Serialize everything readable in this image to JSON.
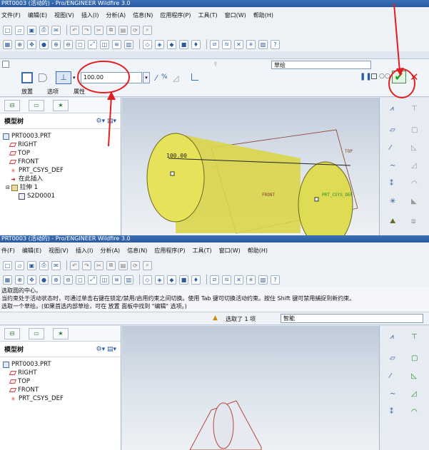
{
  "shot1": {
    "title": "PRT0003 (活动的) - Pro/ENGINEER Wildfire 3.0",
    "menu": [
      "文件(F)",
      "编辑(E)",
      "视图(V)",
      "插入(I)",
      "分析(A)",
      "信息(N)",
      "应用程序(P)",
      "工具(T)",
      "窗口(W)",
      "帮助(H)"
    ],
    "dashboard": {
      "depth_value": "100.00",
      "tabs": [
        "放置",
        "选项",
        "属性"
      ],
      "sketch_select": "草绘",
      "accept_icon": "check-icon",
      "cancel_icon": "x-icon"
    },
    "model_tree": {
      "title": "模型树",
      "items": [
        "PRT0003.PRT",
        "RIGHT",
        "TOP",
        "FRONT",
        "PRT_CSYS_DEF",
        "在此插入",
        "拉伸 1",
        "S2D0001"
      ]
    },
    "viewport_labels": {
      "dimension": "100.00",
      "top": "TOP",
      "front": "FRONT",
      "csys": "PRT_CSYS_DEF"
    },
    "annotation_color": "#e02020"
  },
  "shot2": {
    "title": "PRT0003 (活动的) - Pro/ENGINEER Wildfire 3.0",
    "menu": [
      "件(F)",
      "编辑(E)",
      "视图(V)",
      "插入(I)",
      "分析(A)",
      "信息(N)",
      "应用程序(P)",
      "工具(T)",
      "窗口(W)",
      "帮助(H)"
    ],
    "messages": [
      "选取圆的中心。",
      "当约束处于活动状态时，可通过单击右键在锁定/禁用/启用约束之间切换。使用 Tab 键可切换活动约束。按住 Shift 键可禁用捕捉到新约束。",
      "选取一个草绘。(如果首选内部草绘，可在 放置 面板中找到 \"编辑\" 选项。)"
    ],
    "selection_status": "选取了 1 项",
    "filter_select": "智能",
    "model_tree": {
      "title": "模型树",
      "items": [
        "PRT0003.PRT",
        "RIGHT",
        "TOP",
        "FRONT",
        "PRT_CSYS_DEF"
      ]
    }
  }
}
